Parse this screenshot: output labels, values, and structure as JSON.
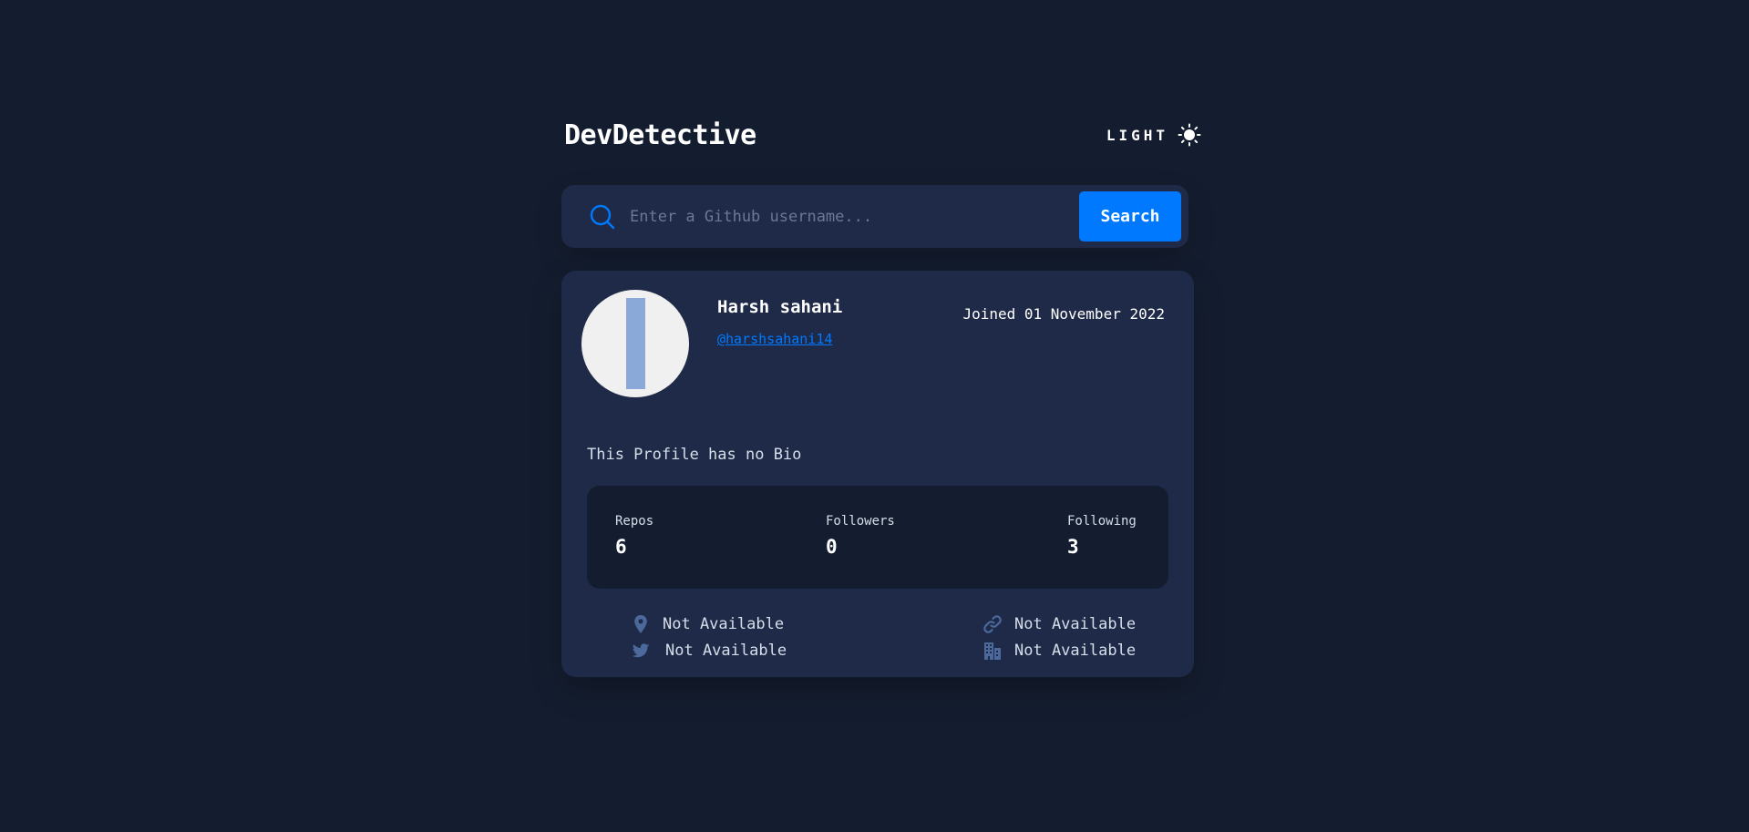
{
  "app": {
    "title": "DevDetective",
    "theme_toggle_label": "LIGHT"
  },
  "search": {
    "placeholder": "Enter a Github username...",
    "value": "",
    "button_label": "Search"
  },
  "profile": {
    "name": "Harsh sahani",
    "username": "@harshsahani14",
    "joined": "Joined 01 November 2022",
    "bio": "This Profile has no Bio",
    "stats": {
      "repos_label": "Repos",
      "repos_value": "6",
      "followers_label": "Followers",
      "followers_value": "0",
      "following_label": "Following",
      "following_value": "3"
    },
    "links": {
      "location": "Not Available",
      "website": "Not Available",
      "twitter": "Not Available",
      "company": "Not Available"
    }
  },
  "icons": {
    "theme": "sun-icon",
    "search": "search-icon",
    "location": "location-pin-icon",
    "website": "link-icon",
    "twitter": "twitter-icon",
    "company": "building-icon"
  },
  "colors": {
    "background": "#141d2f",
    "card": "#1e2a47",
    "accent": "#0079ff",
    "muted_icon": "#4b6a9b"
  }
}
